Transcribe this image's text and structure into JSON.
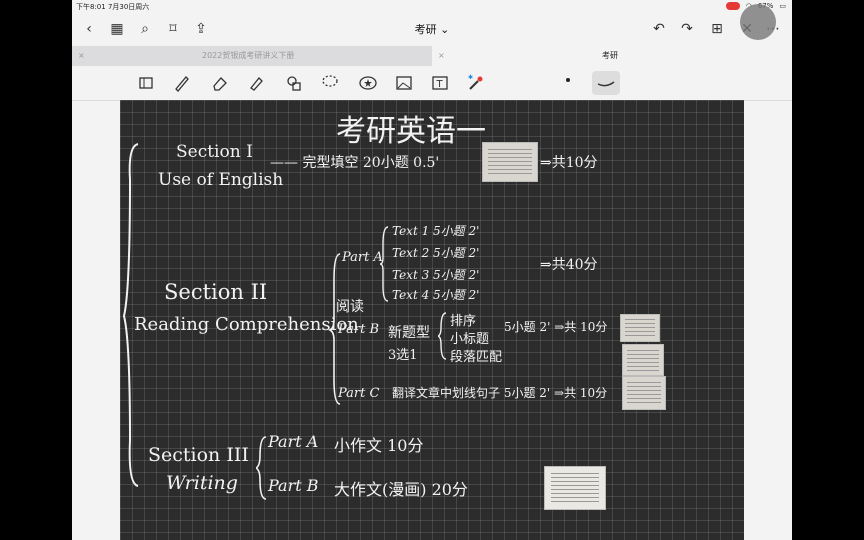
{
  "status_bar": {
    "time_date": "下午8:01   7月30日周六",
    "battery": "67%"
  },
  "nav": {
    "title": "考研 ⌄"
  },
  "tabs": [
    {
      "label": "2022贺银成考研讲义下册",
      "close": "×"
    },
    {
      "label": "考研",
      "close": "×"
    }
  ],
  "note": {
    "title": "考研英语一",
    "section1": {
      "heading": "Section I",
      "subheading": "Use of English",
      "detail": "—— 完型填空 20小题 0.5'",
      "total": "⇒共10分"
    },
    "section2": {
      "heading": "Section II",
      "subheading": "Reading Comprehension",
      "reading_label": "阅读",
      "part_a": {
        "label": "Part A",
        "texts": [
          "Text 1  5小题  2'",
          "Text 2  5小题  2'",
          "Text 3  5小题  2'",
          "Text 4  5小题  2'"
        ],
        "total": "⇒共40分"
      },
      "part_b": {
        "label": "Part B",
        "type": "新题型",
        "choose": "3选1",
        "options": [
          "排序",
          "小标题",
          "段落匹配"
        ],
        "detail": "5小题  2' ⇒共 10分"
      },
      "part_c": {
        "label": "Part C",
        "detail": "翻译文章中划线句子  5小题 2'  ⇒共 10分"
      }
    },
    "section3": {
      "heading": "Section III",
      "subheading": "Writing",
      "part_a": {
        "label": "Part A",
        "detail": "小作文  10分"
      },
      "part_b": {
        "label": "Part B",
        "detail": "大作文(漫画)  20分"
      }
    }
  }
}
